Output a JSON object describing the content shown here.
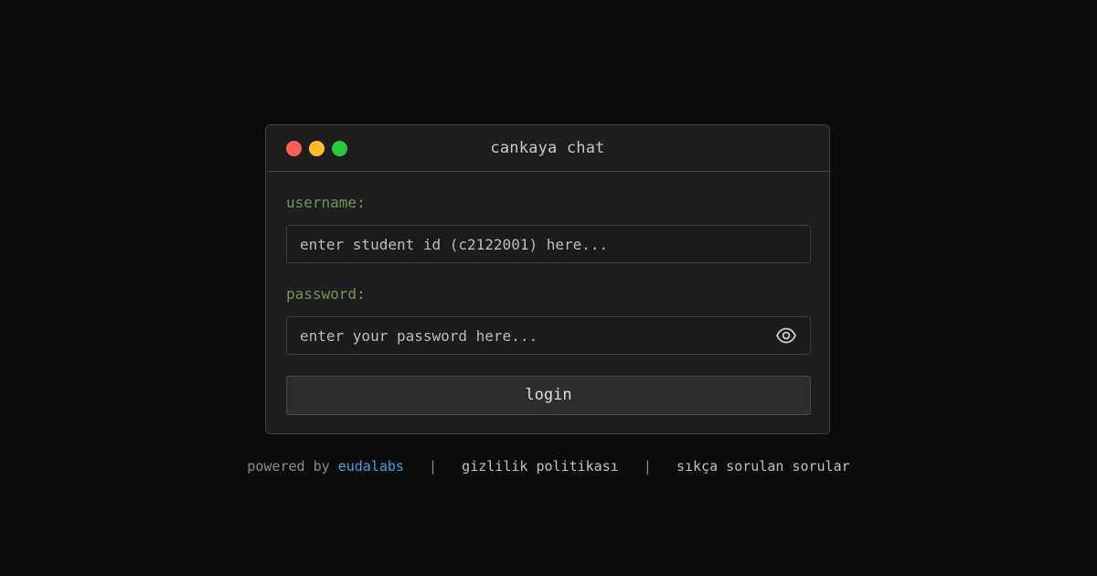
{
  "window": {
    "title": "cankaya chat",
    "traffic_lights": {
      "close_color": "#ff5f57",
      "minimize_color": "#febc2e",
      "maximize_color": "#28c840"
    }
  },
  "form": {
    "username_label": "username:",
    "username_placeholder": "enter student id (c2122001) here...",
    "username_value": "",
    "password_label": "password:",
    "password_placeholder": "enter your password here...",
    "password_value": "",
    "password_toggle_icon": "eye-icon",
    "login_label": "login"
  },
  "footer": {
    "powered_by": "powered by ",
    "brand": "eudalabs",
    "separator": "|",
    "privacy_link": "gizlilik politikası",
    "faq_link": "sıkça sorulan sorular"
  },
  "colors": {
    "background": "#0c0c0c",
    "label_green": "#6a9955",
    "brand_blue": "#4a9be8"
  }
}
